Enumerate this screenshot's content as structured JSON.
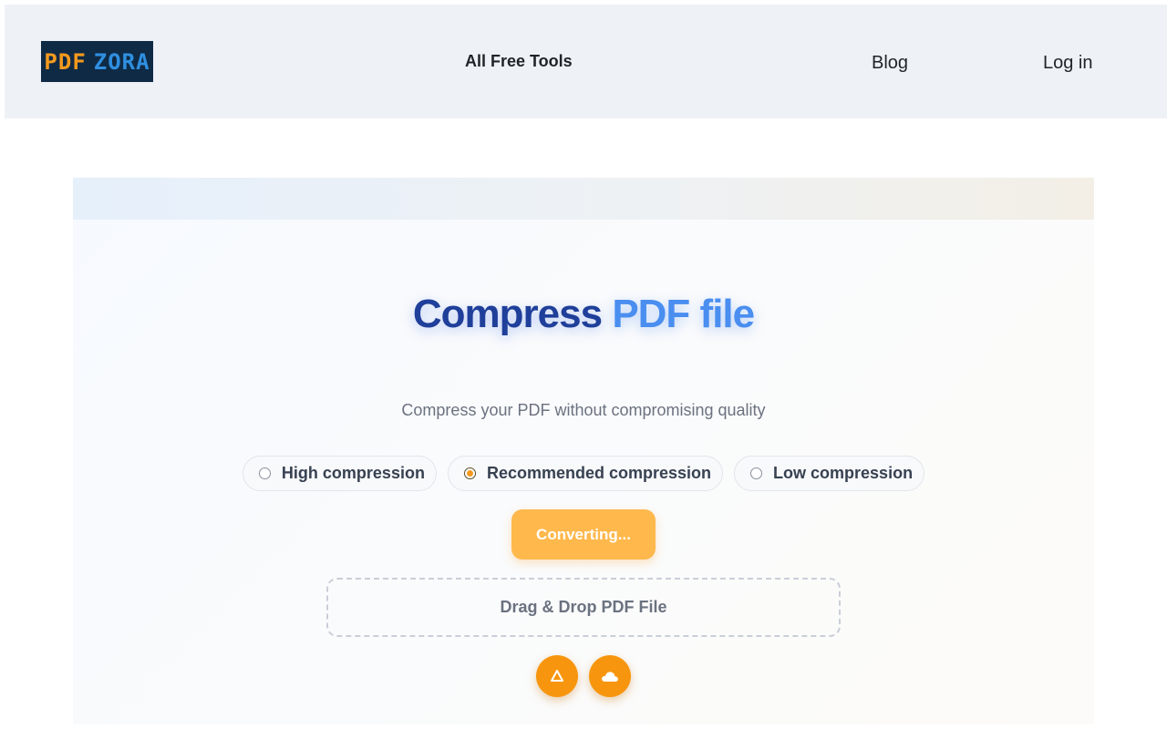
{
  "header": {
    "logo": {
      "part1": "PDF",
      "part2": "ZORA"
    },
    "nav": {
      "all_free_tools": "All Free Tools",
      "blog": "Blog",
      "login": "Log in"
    }
  },
  "main": {
    "title_part1": "Compress",
    "title_part2": "PDF file",
    "subtitle": "Compress your PDF without compromising quality",
    "compression_options": [
      {
        "label": "High compression",
        "selected": false
      },
      {
        "label": "Recommended compression",
        "selected": true
      },
      {
        "label": "Low compression",
        "selected": false
      }
    ],
    "convert_button": "Converting...",
    "dropzone_text": "Drag & Drop PDF File",
    "cloud_buttons": [
      {
        "icon": "google-drive-icon"
      },
      {
        "icon": "cloud-icon"
      }
    ]
  },
  "colors": {
    "accent_orange": "#f7960e",
    "button_orange": "#ffb84c",
    "title_dark_blue": "#1f3f9a",
    "title_light_blue": "#4a8ef0",
    "header_bg": "#eef1f6",
    "logo_bg": "#0f2a45"
  }
}
